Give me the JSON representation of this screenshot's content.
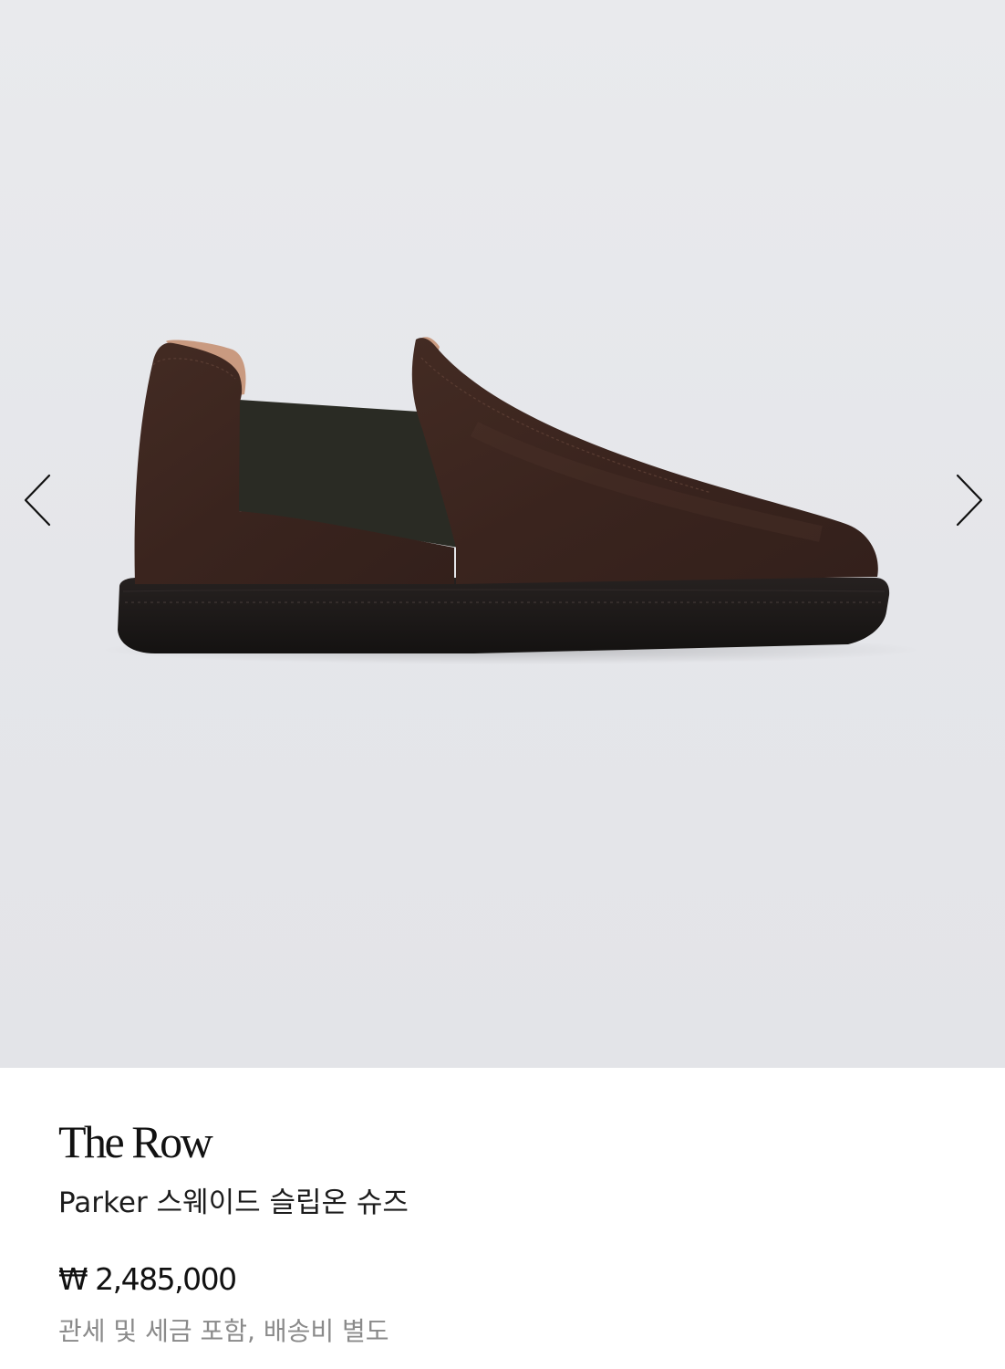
{
  "gallery": {
    "image_subject": "shoe-image",
    "background_color": "#e6e7eb",
    "prev_icon": "chevron-left-icon",
    "next_icon": "chevron-right-icon"
  },
  "product": {
    "brand": "The Row",
    "name": "Parker 스웨이드 슬립온 슈즈",
    "price": "₩ 2,485,000",
    "tax_note": "관세 및 세금 포함, 배송비 별도"
  },
  "colors": {
    "suede": "#3b2620",
    "elastic_gore": "#2a2b24",
    "sole": "#1b1817",
    "lining": "#c99a80"
  }
}
